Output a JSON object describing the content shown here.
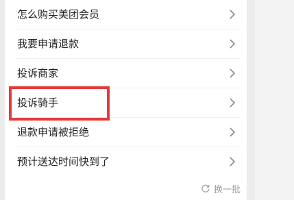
{
  "faq": {
    "items": [
      {
        "label": "怎么购买美团会员"
      },
      {
        "label": "我要申请退款"
      },
      {
        "label": "投诉商家"
      },
      {
        "label": "投诉骑手"
      },
      {
        "label": "退款申请被拒绝"
      },
      {
        "label": "预计送达时间快到了"
      }
    ],
    "highlighted_item": "投诉骑手",
    "refresh_label": "换一批"
  },
  "colors": {
    "highlight_border": "#e53a3a",
    "text": "#222222",
    "muted": "#9a9a9a",
    "card_background": "#ffffff",
    "page_background": "#ececec"
  },
  "icons": {
    "row_chevron": "chevron-right-icon",
    "refresh": "refresh-icon"
  }
}
